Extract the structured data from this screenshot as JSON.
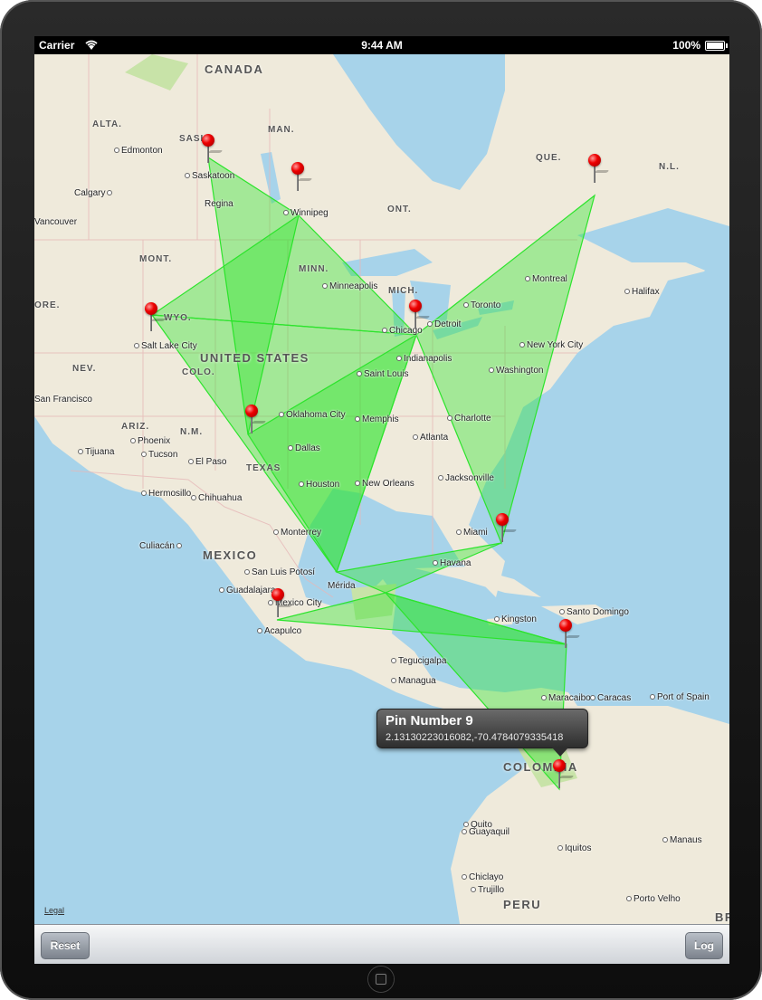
{
  "statusbar": {
    "carrier": "Carrier",
    "time": "9:44 AM",
    "battery": "100%"
  },
  "map": {
    "countries": [
      "CANADA",
      "UNITED STATES",
      "MEXICO",
      "COLOMBIA",
      "PERU",
      "BR"
    ],
    "regions": [
      "ALTA.",
      "SASK",
      "MAN.",
      "ONT.",
      "QUE.",
      "N.L.",
      "MONT.",
      "WYO.",
      "COLO.",
      "MINN.",
      "MICH.",
      "NEV.",
      "ARIZ.",
      "N.M.",
      "TEXAS",
      "ORE."
    ],
    "cities": [
      "Edmonton",
      "Saskatoon",
      "Calgary",
      "Regina",
      "Winnipeg",
      "Vancouver",
      "Minneapolis",
      "Chicago",
      "Detroit",
      "Toronto",
      "Montreal",
      "Halifax",
      "Salt Lake City",
      "New York City",
      "Indianapolis",
      "Washington",
      "Saint Louis",
      "San Francisco",
      "Oklahoma City",
      "Memphis",
      "Charlotte",
      "Atlanta",
      "Phoenix",
      "Tucson",
      "El Paso",
      "Dallas",
      "Tijuana",
      "Houston",
      "New Orleans",
      "Jacksonville",
      "Hermosillo",
      "Chihuahua",
      "Miami",
      "Monterrey",
      "Culiacán",
      "Havana",
      "San Luis Potosí",
      "Mérida",
      "Guadalajara",
      "Mexico City",
      "Santo Domingo",
      "Kingston",
      "Acapulco",
      "Tegucigalpa",
      "Managua",
      "Maracaibo",
      "Caracas",
      "Port of Spain",
      "Quito",
      "Guayaquil",
      "Iquitos",
      "Manaus",
      "Chiclayo",
      "Trujillo",
      "Porto Velho"
    ],
    "legal": "Legal"
  },
  "callout": {
    "title": "Pin Number 9",
    "subtitle": "2.13130223016082,-70.4784079335418"
  },
  "toolbar": {
    "reset": "Reset",
    "log": "Log"
  },
  "colors": {
    "overlay": "#22dd22",
    "pin": "#e00000",
    "water": "#a7d3ea",
    "land": "#efeadb"
  }
}
